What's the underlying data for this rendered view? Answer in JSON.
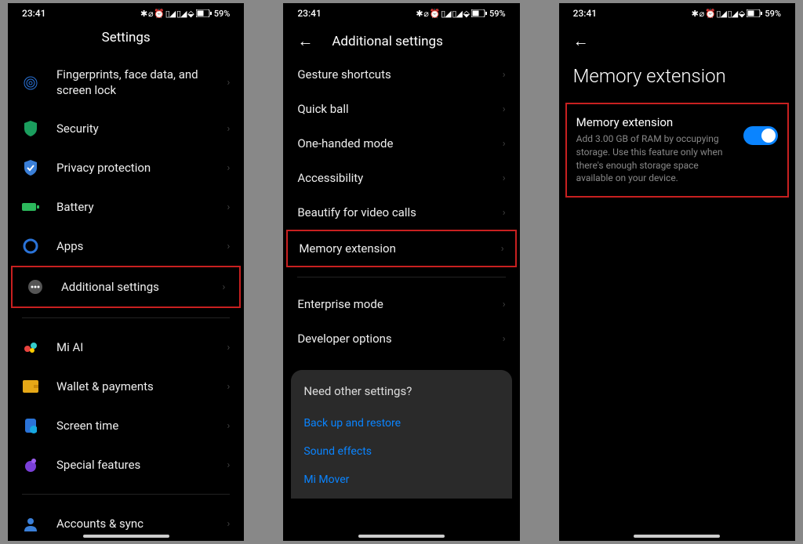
{
  "status": {
    "time": "23:41",
    "icons": "✱ ⌀ ⏰ ▯◢ ▯◢ ⬙",
    "battery": "59%"
  },
  "screen1": {
    "title": "Settings",
    "items": [
      {
        "label": "Fingerprints, face data, and screen lock"
      },
      {
        "label": "Security"
      },
      {
        "label": "Privacy protection"
      },
      {
        "label": "Battery"
      },
      {
        "label": "Apps"
      },
      {
        "label": "Additional settings"
      },
      {
        "label": "Mi AI"
      },
      {
        "label": "Wallet & payments"
      },
      {
        "label": "Screen time"
      },
      {
        "label": "Special features"
      },
      {
        "label": "Accounts & sync"
      }
    ]
  },
  "screen2": {
    "title": "Additional settings",
    "items": [
      {
        "label": "Gesture shortcuts"
      },
      {
        "label": "Quick ball"
      },
      {
        "label": "One-handed mode"
      },
      {
        "label": "Accessibility"
      },
      {
        "label": "Beautify for video calls"
      },
      {
        "label": "Memory extension"
      },
      {
        "label": "Enterprise mode"
      },
      {
        "label": "Developer options"
      }
    ],
    "panel_title": "Need other settings?",
    "links": [
      "Back up and restore",
      "Sound effects",
      "Mi Mover"
    ]
  },
  "screen3": {
    "title": "Memory extension",
    "card_title": "Memory extension",
    "card_desc": "Add 3.00 GB of RAM by occupying storage. Use this feature only when there's enough storage space available on your device."
  }
}
